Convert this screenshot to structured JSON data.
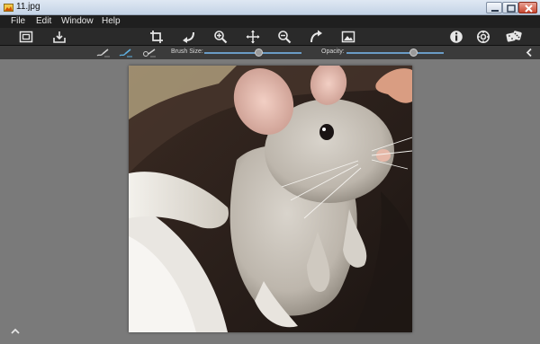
{
  "window": {
    "title": "11.jpg"
  },
  "menu": {
    "items": [
      "File",
      "Edit",
      "Window",
      "Help"
    ]
  },
  "toolbar": {
    "left_icons": [
      "fit-window-icon",
      "save-icon"
    ],
    "center_icons": [
      "crop-icon",
      "rotate-left-icon",
      "zoom-in-icon",
      "pan-icon",
      "zoom-out-icon",
      "rotate-right-icon",
      "image-icon"
    ],
    "right_icons": [
      "info-icon",
      "settings-icon",
      "random-dice-icon"
    ]
  },
  "options": {
    "brush_size_label": "Brush Size:",
    "brush_size_value": 0.56,
    "opacity_label": "Opacity:",
    "opacity_value": 0.69,
    "brushes": [
      "brush-style-1-icon",
      "brush-style-2-icon",
      "brush-style-3-icon"
    ],
    "active_brush": 1
  },
  "image": {
    "subject": "chinchilla photo"
  },
  "colors": {
    "accent": "#6a9cc6",
    "toolbar_bg": "#2a2a2a",
    "canvas_bg": "#7a7a7a"
  }
}
